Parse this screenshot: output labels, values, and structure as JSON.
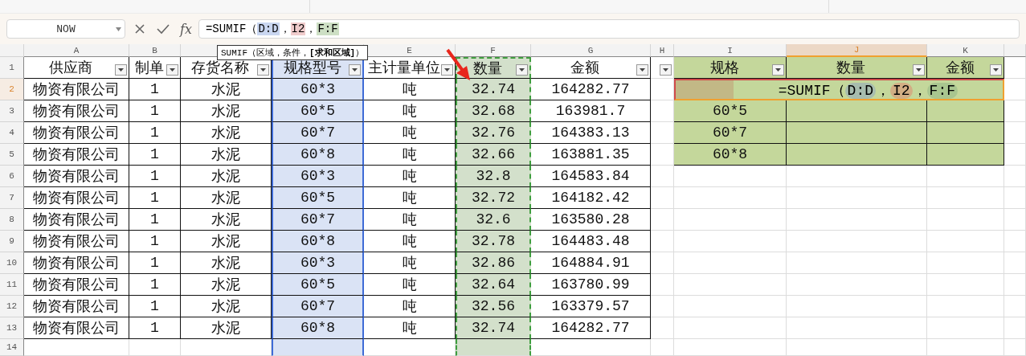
{
  "name_box": "NOW",
  "formula_bar": {
    "fx": "fx",
    "parts": [
      {
        "text": "=SUMIF（",
        "kind": "text"
      },
      {
        "text": "D:D",
        "kind": "ref",
        "color": "#c9d6f0"
      },
      {
        "text": "，",
        "kind": "text"
      },
      {
        "text": "I2",
        "kind": "ref",
        "color": "#f0cccc"
      },
      {
        "text": "，",
        "kind": "text"
      },
      {
        "text": "F:F",
        "kind": "ref",
        "color": "#cddfc4"
      }
    ]
  },
  "tooltip": "SUMIF（区域，条件，**[求和区域]**）",
  "sheet": {
    "columns": [
      {
        "letter": "A",
        "selected": false
      },
      {
        "letter": "B",
        "selected": false
      },
      {},
      {},
      {
        "letter": "E",
        "selected": false
      },
      {
        "letter": "F",
        "selected": false
      },
      {
        "letter": "G",
        "selected": false
      },
      {
        "letter": "H",
        "selected": false
      },
      {
        "letter": "I",
        "selected": false
      },
      {
        "letter": "J",
        "selected": true
      },
      {
        "letter": "K",
        "selected": false
      }
    ],
    "rows": [
      {
        "number": "1",
        "selected": false
      },
      {
        "number": "2",
        "selected": true
      },
      {
        "number": "3",
        "selected": false
      },
      {
        "number": "4",
        "selected": false
      },
      {
        "number": "5",
        "selected": false
      },
      {
        "number": "6",
        "selected": false
      },
      {
        "number": "7",
        "selected": false
      },
      {
        "number": "8",
        "selected": false
      },
      {
        "number": "9",
        "selected": false
      },
      {
        "number": "10",
        "selected": false
      },
      {
        "number": "11",
        "selected": false
      },
      {
        "number": "12",
        "selected": false
      },
      {
        "number": "13",
        "selected": false
      },
      {
        "number": "14",
        "selected": false
      }
    ]
  },
  "table": {
    "columns": [
      {
        "header": "供应商"
      },
      {
        "header": "制单"
      },
      {
        "header": "存货名称"
      },
      {
        "header": "规格型号",
        "kind": "criteria_range",
        "color": "#dae3f5"
      },
      {
        "header": "主计量单位"
      },
      {
        "header": "数量",
        "kind": "sum_range",
        "color": "#d3e0cb"
      },
      {
        "header": "金额"
      }
    ],
    "rows": [
      [
        "物资有限公司",
        "1",
        "水泥",
        "60*3",
        "吨",
        "32.74",
        "164282.77"
      ],
      [
        "物资有限公司",
        "1",
        "水泥",
        "60*5",
        "吨",
        "32.68",
        "163981.7"
      ],
      [
        "物资有限公司",
        "1",
        "水泥",
        "60*7",
        "吨",
        "32.76",
        "164383.13"
      ],
      [
        "物资有限公司",
        "1",
        "水泥",
        "60*8",
        "吨",
        "32.66",
        "163881.35"
      ],
      [
        "物资有限公司",
        "1",
        "水泥",
        "60*3",
        "吨",
        "32.8",
        "164583.84"
      ],
      [
        "物资有限公司",
        "1",
        "水泥",
        "60*5",
        "吨",
        "32.72",
        "164182.42"
      ],
      [
        "物资有限公司",
        "1",
        "水泥",
        "60*7",
        "吨",
        "32.6",
        "163580.28"
      ],
      [
        "物资有限公司",
        "1",
        "水泥",
        "60*8",
        "吨",
        "32.78",
        "164483.48"
      ],
      [
        "物资有限公司",
        "1",
        "水泥",
        "60*3",
        "吨",
        "32.86",
        "164884.91"
      ],
      [
        "物资有限公司",
        "1",
        "水泥",
        "60*5",
        "吨",
        "32.64",
        "163780.99"
      ],
      [
        "物资有限公司",
        "1",
        "水泥",
        "60*7",
        "吨",
        "32.56",
        "163379.57"
      ],
      [
        "物资有限公司",
        "1",
        "水泥",
        "60*8",
        "吨",
        "32.74",
        "164282.77"
      ]
    ]
  },
  "summary": {
    "headers": [
      "规格",
      "数量",
      "金额"
    ],
    "editing_cell": [
      {
        "text": "=SUMIF（",
        "kind": "text"
      },
      {
        "text": "D:D",
        "kind": "ref",
        "color": "#a7bcae"
      },
      {
        "text": "，",
        "kind": "text"
      },
      {
        "text": "I2",
        "kind": "ref",
        "color": "#d2ae84"
      },
      {
        "text": "，",
        "kind": "text"
      },
      {
        "text": "F:F",
        "kind": "ref",
        "color": "#a9c58f"
      }
    ],
    "rows": [
      [
        "60*5"
      ],
      [
        "60*7"
      ],
      [
        "60*8"
      ]
    ]
  }
}
